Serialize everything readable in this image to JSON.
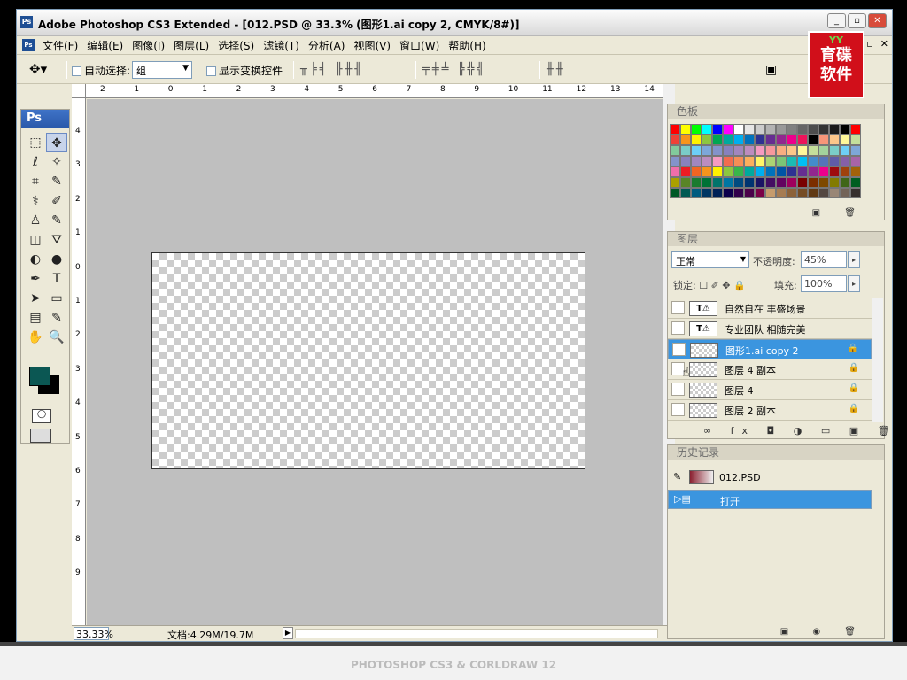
{
  "app": {
    "title": "Adobe Photoshop CS3 Extended - [012.PSD @ 33.3% (图形1.ai copy 2, CMYK/8#)]",
    "icon": "Ps"
  },
  "window_controls": {
    "minimize": "_",
    "restore": "▫",
    "close": "✕"
  },
  "doc_controls": {
    "minimize": "_",
    "restore": "▫",
    "close": "✕"
  },
  "menu": [
    "文件(F)",
    "编辑(E)",
    "图像(I)",
    "图层(L)",
    "选择(S)",
    "滤镜(T)",
    "分析(A)",
    "视图(V)",
    "窗口(W)",
    "帮助(H)"
  ],
  "options": {
    "auto_select_label": "自动选择:",
    "auto_select_value": "组",
    "show_transform_label": "显示变换控件"
  },
  "logo": {
    "tiny": "YY",
    "line1": "育碟",
    "line2": "软件"
  },
  "toolbox": {
    "header": "Ps",
    "tools": [
      "marquee-icon",
      "move-icon",
      "lasso-icon",
      "magic-wand-icon",
      "crop-icon",
      "slice-icon",
      "healing-icon",
      "brush-icon",
      "stamp-icon",
      "history-brush-icon",
      "eraser-icon",
      "bucket-icon",
      "blur-icon",
      "dodge-icon",
      "pen-icon",
      "type-icon",
      "path-select-icon",
      "shape-icon",
      "notes-icon",
      "eyedropper-icon",
      "hand-icon",
      "zoom-icon"
    ],
    "glyphs": [
      "⬚",
      "✥",
      "ℓ",
      "✧",
      "⌗",
      "✎",
      "⚕",
      "✐",
      "♙",
      "✎",
      "◫",
      "⛛",
      "◐",
      "●",
      "✒",
      "T",
      "➤",
      "▭",
      "▤",
      "✎",
      "✋",
      "🔍"
    ],
    "fg_color": "#0b5753",
    "bg_color": "#000000"
  },
  "ruler": {
    "h_labels": [
      "2",
      "1",
      "0",
      "1",
      "2",
      "3",
      "4",
      "5",
      "6",
      "7",
      "8",
      "9",
      "10",
      "11",
      "12",
      "13",
      "14"
    ],
    "v_labels": [
      "4",
      "3",
      "2",
      "1",
      "0",
      "1",
      "2",
      "3",
      "4",
      "5",
      "6",
      "7",
      "8",
      "9"
    ]
  },
  "status": {
    "zoom": "33.33%",
    "doc_info": "文档:4.29M/19.7M"
  },
  "swatches_panel": {
    "title": "色板",
    "colors": [
      "#ff0000",
      "#ffff00",
      "#00ff00",
      "#00ffff",
      "#0000ff",
      "#ff00ff",
      "#ffffff",
      "#e6e6e6",
      "#cccccc",
      "#b3b3b3",
      "#999999",
      "#808080",
      "#666666",
      "#4d4d4d",
      "#333333",
      "#1a1a1a",
      "#000000",
      "#ff0000",
      "#ef4136",
      "#f7941d",
      "#fff200",
      "#8dc63f",
      "#00a651",
      "#00a99d",
      "#00aeef",
      "#0072bc",
      "#2e3192",
      "#662d91",
      "#92278f",
      "#ec008c",
      "#ed145b",
      "#000000",
      "#f69679",
      "#fdc68a",
      "#fff799",
      "#c4df9b",
      "#82ca9c",
      "#7accc8",
      "#6dcff6",
      "#7da7d9",
      "#8393ca",
      "#8781bd",
      "#a186be",
      "#bd8cbf",
      "#f49ac1",
      "#f6989d",
      "#f9ad81",
      "#fdc689",
      "#fff79a",
      "#c4df9b",
      "#a3d39c",
      "#7bcdc8",
      "#6ecff6",
      "#7ea7d8",
      "#8393ca",
      "#8882be",
      "#a187be",
      "#bc8dbf",
      "#f49bc1",
      "#f26c4f",
      "#f68e56",
      "#fbaf5d",
      "#fff568",
      "#acd373",
      "#7cc576",
      "#1cbbb4",
      "#00bff3",
      "#448ccb",
      "#5674b9",
      "#605ca8",
      "#8560a8",
      "#a864a8",
      "#f06eaa",
      "#ed1c24",
      "#f26522",
      "#f7941d",
      "#fff200",
      "#8dc73f",
      "#39b54a",
      "#00a99d",
      "#00aeef",
      "#0072bc",
      "#0054a6",
      "#2e3192",
      "#662d91",
      "#92278f",
      "#ec008c",
      "#9e0b0f",
      "#a0410d",
      "#a36209",
      "#aba000",
      "#598527",
      "#1a7b30",
      "#007236",
      "#00746b",
      "#0076a3",
      "#004b80",
      "#003471",
      "#1b1464",
      "#440e62",
      "#630460",
      "#9e005d",
      "#790000",
      "#7b2e00",
      "#7d4900",
      "#827b00",
      "#406618",
      "#005e20",
      "#005826",
      "#005952",
      "#005b7f",
      "#003663",
      "#002157",
      "#0d004c",
      "#32004b",
      "#4b0049",
      "#7b0046",
      "#c69c6d",
      "#a67c52",
      "#8c6239",
      "#754c24",
      "#603913",
      "#534741",
      "#998675",
      "#736357",
      "#362f2d"
    ]
  },
  "layers_panel": {
    "title": "图层",
    "blend_mode": "正常",
    "opacity_label": "不透明度:",
    "opacity": "45%",
    "lock_label": "锁定:",
    "lock_icons": "☐ ✐ ✥ 🔒",
    "fill_label": "填充:",
    "fill": "100%",
    "layers": [
      {
        "name": "自然自在  丰盛场景",
        "type": "text",
        "thumb": "T⚠"
      },
      {
        "name": "专业团队  相随完美",
        "type": "text",
        "thumb": "T⚠"
      },
      {
        "name": "图形1.ai copy 2",
        "type": "smart",
        "selected": true
      },
      {
        "name": "图层 4 副本",
        "type": "raster"
      },
      {
        "name": "图层 4",
        "type": "raster"
      },
      {
        "name": "图层 2 副本",
        "type": "raster"
      }
    ],
    "footer_icons": "∞ fx ◘ ◑ ▭ ▣ 🗑"
  },
  "history_panel": {
    "title": "历史记录",
    "snapshot": "012.PSD",
    "steps": [
      "打开"
    ],
    "footer_icons": "▣ ◉ 🗑"
  },
  "bottom_watermark": "PHOTOSHOP CS3 & CORLDRAW 12"
}
